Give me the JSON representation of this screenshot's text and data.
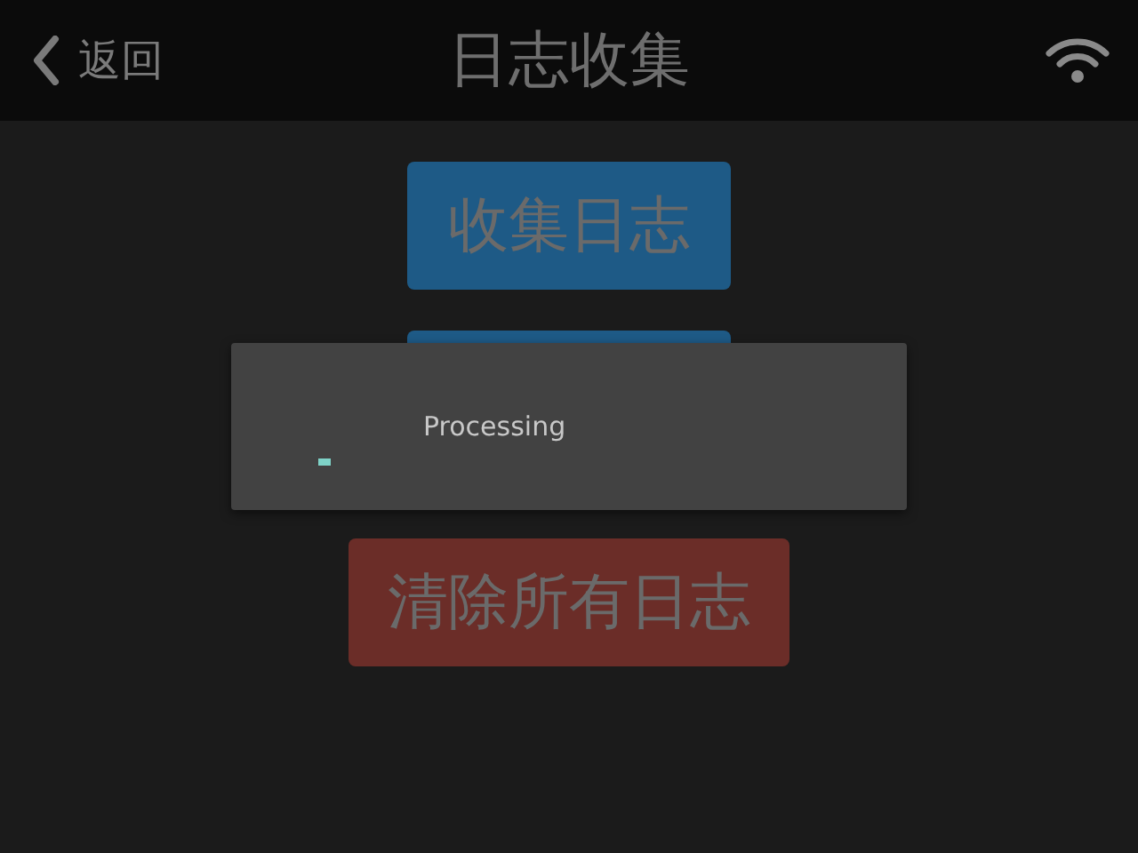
{
  "nav": {
    "back_label": "返回",
    "title": "日志收集"
  },
  "buttons": [
    {
      "kind": "primary",
      "label": "收集日志"
    },
    {
      "kind": "primary"
    },
    {
      "kind": "danger",
      "label": "清除所有日志"
    }
  ],
  "dialog": {
    "message": "Processing"
  }
}
